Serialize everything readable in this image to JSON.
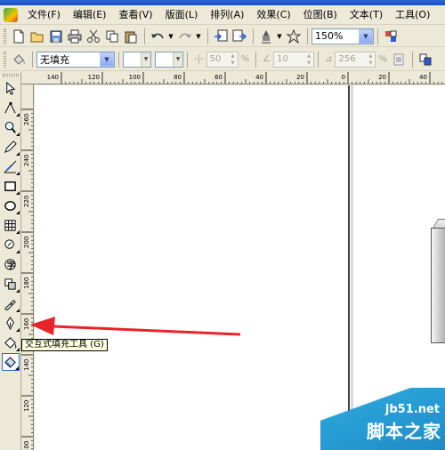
{
  "menu": {
    "items": [
      "文件(F)",
      "编辑(E)",
      "查看(V)",
      "版面(L)",
      "排列(A)",
      "效果(C)",
      "位图(B)",
      "文本(T)",
      "工具(O)"
    ]
  },
  "standard_toolbar": {
    "zoom_value": "150%"
  },
  "property_bar": {
    "fill_type": "无填充",
    "midpoint_value": "50",
    "midpoint_unit": "%",
    "angle_value": "10",
    "edge_pad_value": "256",
    "edge_pad_unit": "%"
  },
  "ruler_top": {
    "labels": [
      "140",
      "120",
      "100",
      "80",
      "60",
      "40",
      "20",
      "0",
      "20",
      "40"
    ]
  },
  "ruler_left": {
    "labels": [
      "260",
      "240",
      "220",
      "200",
      "180",
      "160",
      "140",
      "120",
      "100"
    ]
  },
  "tooltip": {
    "text": "交互式填充工具 (G)"
  },
  "watermark": {
    "site": "jb51.net",
    "name": "脚本之家"
  },
  "colors": {
    "arrow": "#e8232a",
    "page_border": "#3c3c3c",
    "watermark_blue": "#2aa1d8"
  }
}
